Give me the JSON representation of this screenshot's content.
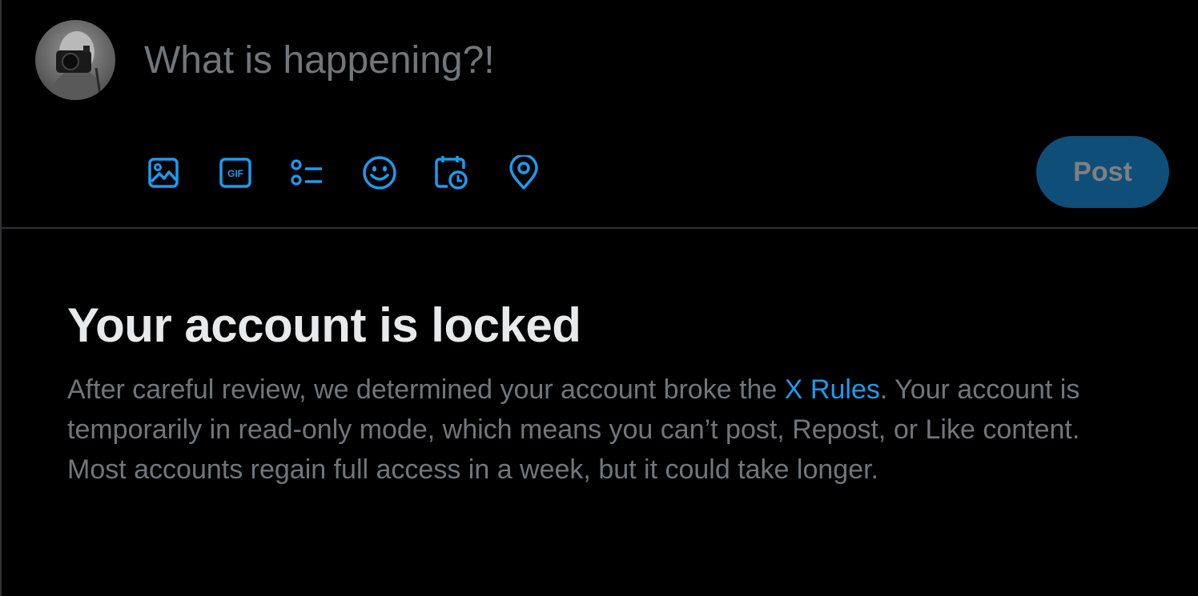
{
  "composer": {
    "placeholder": "What is happening?!",
    "avatar_alt": "user-avatar",
    "toolbar": [
      {
        "name": "media-icon"
      },
      {
        "name": "gif-icon",
        "text": "GIF"
      },
      {
        "name": "poll-icon"
      },
      {
        "name": "emoji-icon"
      },
      {
        "name": "schedule-icon"
      },
      {
        "name": "location-icon"
      }
    ],
    "post_label": "Post"
  },
  "notice": {
    "title": "Your account is locked",
    "body_before": "After careful review, we determined your account broke the ",
    "link_text": "X Rules",
    "body_after": ". Your account is temporarily in read-only mode, which means you can’t post, Repost, or Like content. Most accounts regain full access in a week, but it could take longer."
  },
  "colors": {
    "background": "#000000",
    "accent": "#1d9bf0",
    "post_button_disabled": "#0f4e79",
    "muted_text": "#71767b",
    "divider": "#2f3336"
  }
}
